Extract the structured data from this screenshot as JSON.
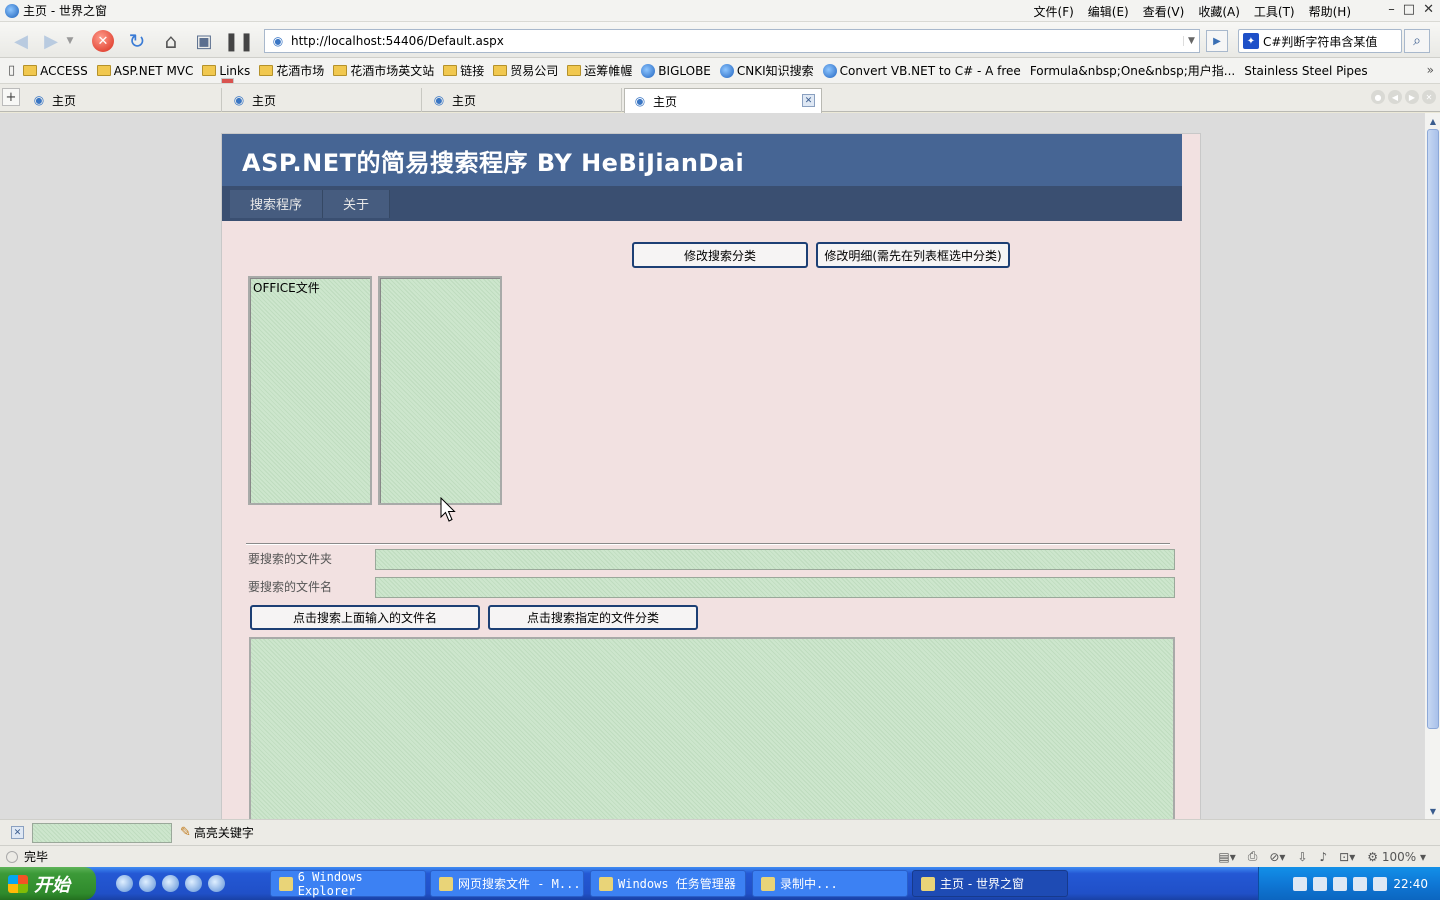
{
  "window": {
    "title": "主页 - 世界之窗",
    "menu": [
      "文件(F)",
      "编辑(E)",
      "查看(V)",
      "收藏(A)",
      "工具(T)",
      "帮助(H)"
    ]
  },
  "address": {
    "url": "http://localhost:54406/Default.aspx"
  },
  "search": {
    "value": "C#判断字符串含某值"
  },
  "favorites": [
    {
      "label": "ACCESS",
      "icon": "folder-icon"
    },
    {
      "label": "ASP.NET MVC",
      "icon": "folder-icon"
    },
    {
      "label": "Links",
      "icon": "folder-icon"
    },
    {
      "label": "花酒市场",
      "icon": "folder-icon"
    },
    {
      "label": "花酒市场英文站",
      "icon": "folder-icon"
    },
    {
      "label": "链接",
      "icon": "folder-icon"
    },
    {
      "label": "贸易公司",
      "icon": "folder-icon"
    },
    {
      "label": "运筹帷幄",
      "icon": "folder-icon"
    },
    {
      "label": "BIGLOBE",
      "icon": "ie-icon"
    },
    {
      "label": "CNKI知识搜索",
      "icon": "ie-icon"
    },
    {
      "label": "Convert VB.NET to C# - A free",
      "icon": "ie-icon"
    },
    {
      "label": "Formula&nbsp;One&nbsp;用户指...",
      "icon": "page-icon"
    },
    {
      "label": "Stainless Steel Pipes",
      "icon": "page-icon"
    }
  ],
  "tabs": [
    {
      "label": "主页"
    },
    {
      "label": "主页"
    },
    {
      "label": "主页"
    },
    {
      "label": "主页"
    }
  ],
  "site": {
    "header_title": "ASP.NET的简易搜索程序  BY HeBiJianDai",
    "nav": [
      "搜索程序",
      "关于"
    ],
    "btn_modify_category": "修改搜索分类",
    "btn_modify_detail": "修改明细(需先在列表框选中分类)",
    "category_list": [
      "OFFICE文件"
    ],
    "label_folder": "要搜索的文件夹",
    "label_filename": "要搜索的文件名",
    "btn_search_name": "点击搜索上面输入的文件名",
    "btn_search_category": "点击搜索指定的文件分类"
  },
  "findbar": {
    "highlight_label": "高亮关键字"
  },
  "status": {
    "text": "完毕",
    "zoom": "100%"
  },
  "taskbar": {
    "start": "开始",
    "tasks": [
      "6 Windows Explorer",
      "网页搜索文件 - M...",
      "Windows 任务管理器",
      "录制中...",
      "主页 - 世界之窗"
    ],
    "clock": "22:40"
  }
}
